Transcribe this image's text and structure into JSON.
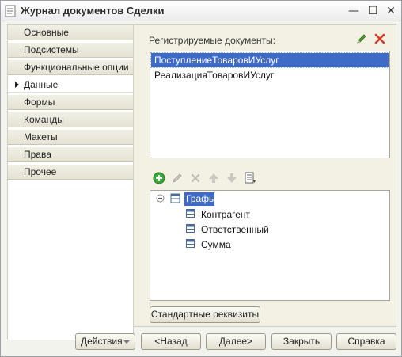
{
  "window": {
    "title": "Журнал документов Сделки",
    "minimize_glyph": "—",
    "maximize_glyph": "☐",
    "close_glyph": "✕"
  },
  "sidebar": {
    "items": [
      {
        "label": "Основные",
        "active": false
      },
      {
        "label": "Подсистемы",
        "active": false
      },
      {
        "label": "Функциональные опции",
        "active": false
      },
      {
        "label": "Данные",
        "active": true
      },
      {
        "label": "Формы",
        "active": false
      },
      {
        "label": "Команды",
        "active": false
      },
      {
        "label": "Макеты",
        "active": false
      },
      {
        "label": "Права",
        "active": false
      },
      {
        "label": "Прочее",
        "active": false
      }
    ]
  },
  "main": {
    "registered_label": "Регистрируемые документы:",
    "documents": [
      "ПоступлениеТоваровИУслуг",
      "РеализацияТоваровИУслуг"
    ],
    "selected_document_index": 0,
    "tree": {
      "root": "Графы",
      "children": [
        "Контрагент",
        "Ответственный",
        "Сумма"
      ]
    },
    "standard_attributes_button": "Стандартные реквизиты"
  },
  "footer": {
    "actions_label": "Действия",
    "back_label": "<Назад",
    "next_label": "Далее>",
    "close_label": "Закрыть",
    "help_label": "Справка"
  },
  "colors": {
    "selection": "#3e6bc7",
    "add_green": "#3aa83a",
    "delete_red": "#d23a2a",
    "edit_green": "#4f9a2e"
  },
  "icons": [
    "app-icon",
    "edit-icon",
    "delete-icon",
    "add-icon",
    "move-up-icon",
    "move-down-icon",
    "list-icon",
    "collapse-icon",
    "table-icon",
    "attribute-icon"
  ]
}
